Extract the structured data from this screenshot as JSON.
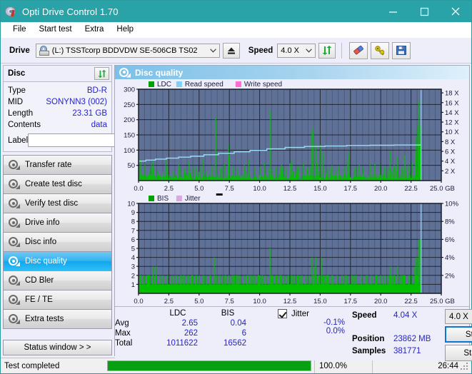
{
  "window": {
    "title": "Opti Drive Control 1.70",
    "icon": "disc-icon",
    "minimize": "minimize-icon",
    "maximize": "maximize-icon",
    "close": "close-icon"
  },
  "menu": {
    "items": [
      "File",
      "Start test",
      "Extra",
      "Help"
    ]
  },
  "toolbar": {
    "drive_label": "Drive",
    "drive_value": "(L:)  TSSTcorp BDDVDW SE-506CB TS02",
    "eject_icon": "eject-icon",
    "speed_label": "Speed",
    "speed_value": "4.0 X",
    "refresh_icon": "refresh-icon",
    "erase_icon": "eraser-icon",
    "settings_icon": "tools-icon",
    "save_icon": "save-icon"
  },
  "disc": {
    "title": "Disc",
    "refresh_icon": "refresh-icon",
    "rows": [
      {
        "key": "Type",
        "value": "BD-R"
      },
      {
        "key": "MID",
        "value": "SONYNN3 (002)"
      },
      {
        "key": "Length",
        "value": "23.31 GB"
      },
      {
        "key": "Contents",
        "value": "data"
      }
    ],
    "label_key": "Label",
    "label_value": "",
    "label_placeholder": "",
    "label_btn_icon": "disc-label-icon"
  },
  "nav": {
    "items": [
      {
        "label": "Transfer rate",
        "active": false
      },
      {
        "label": "Create test disc",
        "active": false
      },
      {
        "label": "Verify test disc",
        "active": false
      },
      {
        "label": "Drive info",
        "active": false
      },
      {
        "label": "Disc info",
        "active": false
      },
      {
        "label": "Disc quality",
        "active": true
      },
      {
        "label": "CD Bler",
        "active": false
      },
      {
        "label": "FE / TE",
        "active": false
      },
      {
        "label": "Extra tests",
        "active": false
      }
    ],
    "status_window": "Status window > >"
  },
  "content": {
    "header": "Disc quality",
    "header_icon": "disc-quality-icon"
  },
  "chart_data": [
    {
      "type": "line",
      "name": "ldc-chart",
      "title": "",
      "legend": [
        {
          "label": "LDC",
          "color": "#00a000"
        },
        {
          "label": "Read speed",
          "color": "#7ed0f5"
        },
        {
          "label": "Write speed",
          "color": "#ff6ad5"
        }
      ],
      "legend_position": "top-left",
      "grid": true,
      "plot_bg": "#5f7197",
      "xlabel": "GB",
      "xlim": [
        0,
        25
      ],
      "xticks": [
        0.0,
        2.5,
        5.0,
        7.5,
        10.0,
        12.5,
        15.0,
        17.5,
        20.0,
        22.5,
        25.0
      ],
      "xticklabels": [
        "0.0",
        "2.5",
        "5.0",
        "7.5",
        "10.0",
        "12.5",
        "15.0",
        "17.5",
        "20.0",
        "22.5",
        "25.0 GB"
      ],
      "ylabel": "",
      "ylim": [
        0,
        300
      ],
      "yticks": [
        50,
        100,
        150,
        200,
        250,
        300
      ],
      "yticklabels": [
        "50",
        "100",
        "150",
        "200",
        "250",
        "300"
      ],
      "y2label": "X",
      "y2lim": [
        0,
        18.75
      ],
      "y2ticks": [
        2,
        4,
        6,
        8,
        10,
        12,
        14,
        16,
        18
      ],
      "y2ticklabels": [
        "2 X",
        "4 X",
        "6 X",
        "8 X",
        "10 X",
        "12 X",
        "14 X",
        "16 X",
        "18 X"
      ],
      "data_end_x": 23.31,
      "series": [
        {
          "name": "LDC",
          "color": "#00c000",
          "kind": "impulse",
          "baseline_avg": 2.65,
          "note": "dense green spikes, baseline band ~5-25, occasional tall spikes",
          "spikes": [
            [
              0.15,
              68
            ],
            [
              0.55,
              30
            ],
            [
              0.9,
              26
            ],
            [
              1.2,
              40
            ],
            [
              1.6,
              34
            ],
            [
              2.0,
              28
            ],
            [
              2.4,
              44
            ],
            [
              2.9,
              30
            ],
            [
              3.3,
              55
            ],
            [
              3.8,
              38
            ],
            [
              4.2,
              62
            ],
            [
              4.7,
              34
            ],
            [
              5.1,
              44
            ],
            [
              5.6,
              30
            ],
            [
              6.0,
              48
            ],
            [
              6.35,
              208
            ],
            [
              6.7,
              40
            ],
            [
              7.1,
              56
            ],
            [
              7.45,
              118
            ],
            [
              7.5,
              84
            ],
            [
              7.8,
              46
            ],
            [
              8.2,
              38
            ],
            [
              8.7,
              52
            ],
            [
              9.1,
              70
            ],
            [
              9.6,
              40
            ],
            [
              10.0,
              46
            ],
            [
              10.4,
              60
            ],
            [
              10.9,
              230
            ],
            [
              11.3,
              44
            ],
            [
              11.8,
              52
            ],
            [
              12.2,
              38
            ],
            [
              12.7,
              66
            ],
            [
              13.1,
              48
            ],
            [
              13.6,
              58
            ],
            [
              14.0,
              44
            ],
            [
              14.35,
              160
            ],
            [
              14.45,
              175
            ],
            [
              14.6,
              120
            ],
            [
              14.8,
              60
            ],
            [
              15.05,
              118
            ],
            [
              15.2,
              92
            ],
            [
              15.6,
              42
            ],
            [
              16.0,
              50
            ],
            [
              16.5,
              48
            ],
            [
              17.0,
              46
            ],
            [
              17.35,
              92
            ],
            [
              17.8,
              38
            ],
            [
              18.2,
              52
            ],
            [
              18.6,
              44
            ],
            [
              19.1,
              40
            ],
            [
              19.5,
              56
            ],
            [
              19.9,
              48
            ],
            [
              20.3,
              46
            ],
            [
              20.75,
              98
            ],
            [
              21.1,
              52
            ],
            [
              21.4,
              78
            ],
            [
              21.7,
              44
            ],
            [
              22.0,
              82
            ],
            [
              22.3,
              50
            ],
            [
              22.6,
              60
            ],
            [
              22.85,
              90
            ],
            [
              22.95,
              140
            ],
            [
              23.05,
              175
            ],
            [
              23.12,
              120
            ],
            [
              23.2,
              262
            ],
            [
              23.25,
              180
            ],
            [
              23.3,
              120
            ]
          ]
        },
        {
          "name": "Read speed",
          "color": "#9fdcf8",
          "kind": "step-line",
          "points_x_speed": [
            [
              0.0,
              4.0
            ],
            [
              0.6,
              4.2
            ],
            [
              1.4,
              4.4
            ],
            [
              2.3,
              4.6
            ],
            [
              3.3,
              4.8
            ],
            [
              4.3,
              5.0
            ],
            [
              5.4,
              5.3
            ],
            [
              6.6,
              5.6
            ],
            [
              7.9,
              5.9
            ],
            [
              9.2,
              6.2
            ],
            [
              10.6,
              6.5
            ],
            [
              12.1,
              6.8
            ],
            [
              13.7,
              7.0
            ],
            [
              15.4,
              7.1
            ],
            [
              17.2,
              7.2
            ],
            [
              19.1,
              7.25
            ],
            [
              21.1,
              7.3
            ],
            [
              23.3,
              7.35
            ]
          ]
        },
        {
          "name": "vertical-cursor",
          "color": "#7ed0f5",
          "kind": "vline",
          "x": 23.33
        }
      ]
    },
    {
      "type": "line",
      "name": "bis-chart",
      "title": "",
      "legend": [
        {
          "label": "BIS",
          "color": "#00a000"
        },
        {
          "label": "Jitter",
          "color": "#d9a8e0"
        }
      ],
      "legend_position": "top-left",
      "grid": true,
      "plot_bg": "#5f7197",
      "xlabel": "GB",
      "xlim": [
        0,
        25
      ],
      "xticks": [
        0.0,
        2.5,
        5.0,
        7.5,
        10.0,
        12.5,
        15.0,
        17.5,
        20.0,
        22.5,
        25.0
      ],
      "xticklabels": [
        "0.0",
        "2.5",
        "5.0",
        "7.5",
        "10.0",
        "12.5",
        "15.0",
        "17.5",
        "20.0",
        "22.5",
        "25.0 GB"
      ],
      "ylim": [
        0,
        10
      ],
      "yticks": [
        1,
        2,
        3,
        4,
        5,
        6,
        7,
        8,
        9,
        10
      ],
      "yticklabels": [
        "1",
        "2",
        "3",
        "4",
        "5",
        "6",
        "7",
        "8",
        "9",
        "10"
      ],
      "y2label": "%",
      "y2lim": [
        0,
        10
      ],
      "y2ticks": [
        2,
        4,
        6,
        8,
        10
      ],
      "y2ticklabels": [
        "2%",
        "4%",
        "6%",
        "8%",
        "10%"
      ],
      "data_end_x": 23.31,
      "series": [
        {
          "name": "BIS",
          "color": "#00c000",
          "kind": "impulse",
          "baseline": 1.0,
          "note": "solid green band up to 1, frequent spikes to 2, occasional 3-5",
          "spikes": [
            [
              0.2,
              2
            ],
            [
              0.45,
              2
            ],
            [
              0.7,
              2
            ],
            [
              0.95,
              2
            ],
            [
              1.15,
              3
            ],
            [
              1.25,
              2
            ],
            [
              1.5,
              3
            ],
            [
              1.75,
              2
            ],
            [
              2.0,
              2
            ],
            [
              2.4,
              2
            ],
            [
              2.75,
              2
            ],
            [
              3.0,
              2
            ],
            [
              3.2,
              2
            ],
            [
              3.45,
              2
            ],
            [
              3.8,
              2
            ],
            [
              4.1,
              2
            ],
            [
              4.4,
              2
            ],
            [
              4.7,
              2
            ],
            [
              5.0,
              2
            ],
            [
              5.3,
              2
            ],
            [
              5.6,
              2
            ],
            [
              5.9,
              2
            ],
            [
              6.25,
              4
            ],
            [
              6.45,
              2
            ],
            [
              6.7,
              2
            ],
            [
              6.95,
              2
            ],
            [
              7.2,
              2
            ],
            [
              7.5,
              2
            ],
            [
              7.8,
              2
            ],
            [
              8.1,
              2
            ],
            [
              8.4,
              2
            ],
            [
              8.7,
              2
            ],
            [
              9.0,
              2
            ],
            [
              9.3,
              2
            ],
            [
              9.6,
              2
            ],
            [
              9.9,
              2
            ],
            [
              10.2,
              2
            ],
            [
              10.5,
              2
            ],
            [
              10.85,
              5
            ],
            [
              11.1,
              2
            ],
            [
              11.4,
              2
            ],
            [
              11.7,
              2
            ],
            [
              12.0,
              2
            ],
            [
              12.3,
              2
            ],
            [
              12.6,
              2
            ],
            [
              12.9,
              2
            ],
            [
              13.2,
              2
            ],
            [
              13.5,
              2
            ],
            [
              13.8,
              2
            ],
            [
              14.1,
              2
            ],
            [
              14.35,
              4
            ],
            [
              14.5,
              3
            ],
            [
              14.65,
              4
            ],
            [
              14.9,
              2
            ],
            [
              15.1,
              4
            ],
            [
              15.3,
              2
            ],
            [
              15.6,
              2
            ],
            [
              16.0,
              2
            ],
            [
              16.4,
              2
            ],
            [
              16.8,
              2
            ],
            [
              17.2,
              2
            ],
            [
              17.6,
              2
            ],
            [
              18.0,
              2
            ],
            [
              18.4,
              2
            ],
            [
              18.8,
              2
            ],
            [
              19.2,
              2
            ],
            [
              19.6,
              2
            ],
            [
              20.0,
              2
            ],
            [
              20.4,
              2
            ],
            [
              20.8,
              3
            ],
            [
              21.1,
              2
            ],
            [
              21.4,
              3
            ],
            [
              21.7,
              2
            ],
            [
              22.0,
              2
            ],
            [
              22.3,
              2
            ],
            [
              22.6,
              2
            ],
            [
              22.8,
              3
            ],
            [
              22.95,
              4
            ],
            [
              23.05,
              4
            ],
            [
              23.15,
              6
            ],
            [
              23.25,
              6
            ]
          ]
        },
        {
          "name": "vertical-cursor",
          "color": "#7ed0f5",
          "kind": "vline",
          "x": 23.33
        }
      ]
    }
  ],
  "stats": {
    "col_headers": [
      "LDC",
      "BIS"
    ],
    "rows": [
      {
        "key": "Avg",
        "ldc": "2.65",
        "bis": "0.04",
        "jitter": "-0.1%"
      },
      {
        "key": "Max",
        "ldc": "262",
        "bis": "6",
        "jitter": "0.0%"
      },
      {
        "key": "Total",
        "ldc": "1011622",
        "bis": "16562",
        "jitter": ""
      }
    ],
    "jitter_label": "Jitter",
    "jitter_checked": true,
    "speed_key": "Speed",
    "speed_value": "4.04 X",
    "position_key": "Position",
    "position_value": "23862 MB",
    "samples_key": "Samples",
    "samples_value": "381771",
    "speed_select": "4.0 X",
    "start_full": "Start full",
    "start_part": "Start part"
  },
  "statusbar": {
    "message": "Test completed",
    "progress_pct": 100.0,
    "progress_text": "100.0%",
    "elapsed": "26:44"
  }
}
